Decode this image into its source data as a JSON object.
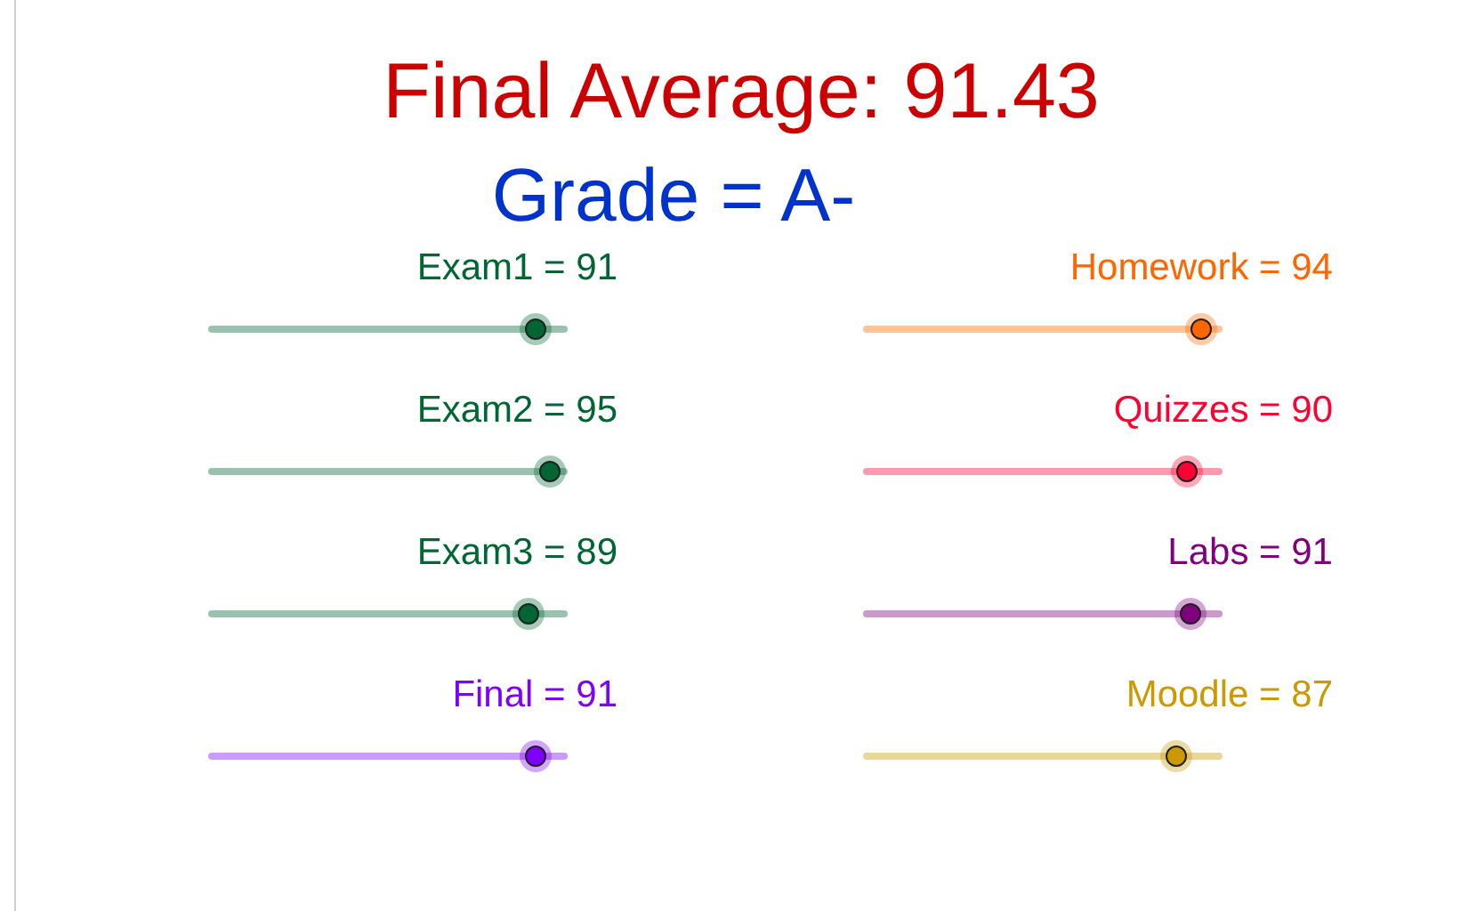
{
  "title": "Final Average: 91.43",
  "grade": "Grade = A-",
  "sliders": [
    {
      "label": "Exam1 = 91",
      "level": 0.91,
      "color": "#006633"
    },
    {
      "label": "Homework = 94",
      "level": 0.94,
      "color": "#ff6600"
    },
    {
      "label": "Exam2 = 95",
      "level": 0.95,
      "color": "#006633"
    },
    {
      "label": "Quizzes = 90",
      "level": 0.9,
      "color": "#ff0033"
    },
    {
      "label": "Exam3 = 89",
      "level": 0.89,
      "color": "#006633"
    },
    {
      "label": "Labs = 91",
      "level": 0.91,
      "color": "#800080"
    },
    {
      "label": "Final = 91",
      "level": 0.91,
      "color": "#7f00ff"
    },
    {
      "label": "Moodle = 87",
      "level": 0.87,
      "color": "#cc9900"
    }
  ]
}
